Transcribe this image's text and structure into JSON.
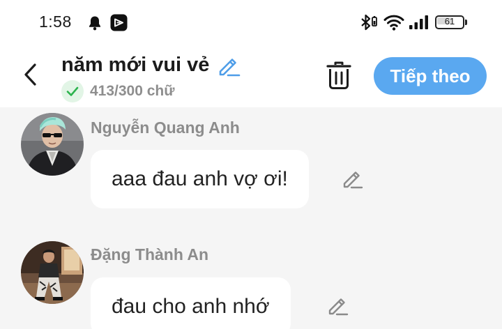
{
  "status_bar": {
    "time": "1:58",
    "battery_level": "61",
    "battery_fraction": 0.61,
    "icons": [
      "bell-icon",
      "app-notification-icon",
      "bluetooth-icon",
      "wifi-icon",
      "signal-icon",
      "battery-icon"
    ]
  },
  "header": {
    "title": "năm mới vui vẻ",
    "char_count": "413/300 chữ",
    "next_label": "Tiếp theo",
    "icons": [
      "back-arrow-icon",
      "pencil-icon",
      "check-icon",
      "trash-icon"
    ]
  },
  "colors": {
    "accent_blue": "#5aa8f0",
    "check_green": "#2bb34d",
    "check_bg": "#e2f5e6",
    "background": "#f5f5f5",
    "sender_gray": "#8c8c8c"
  },
  "messages": [
    {
      "sender": "Nguyễn Quang Anh",
      "text": "aaa đau anh vợ ơi!"
    },
    {
      "sender": "Đặng Thành An",
      "text": "đau cho anh nhớ"
    }
  ]
}
